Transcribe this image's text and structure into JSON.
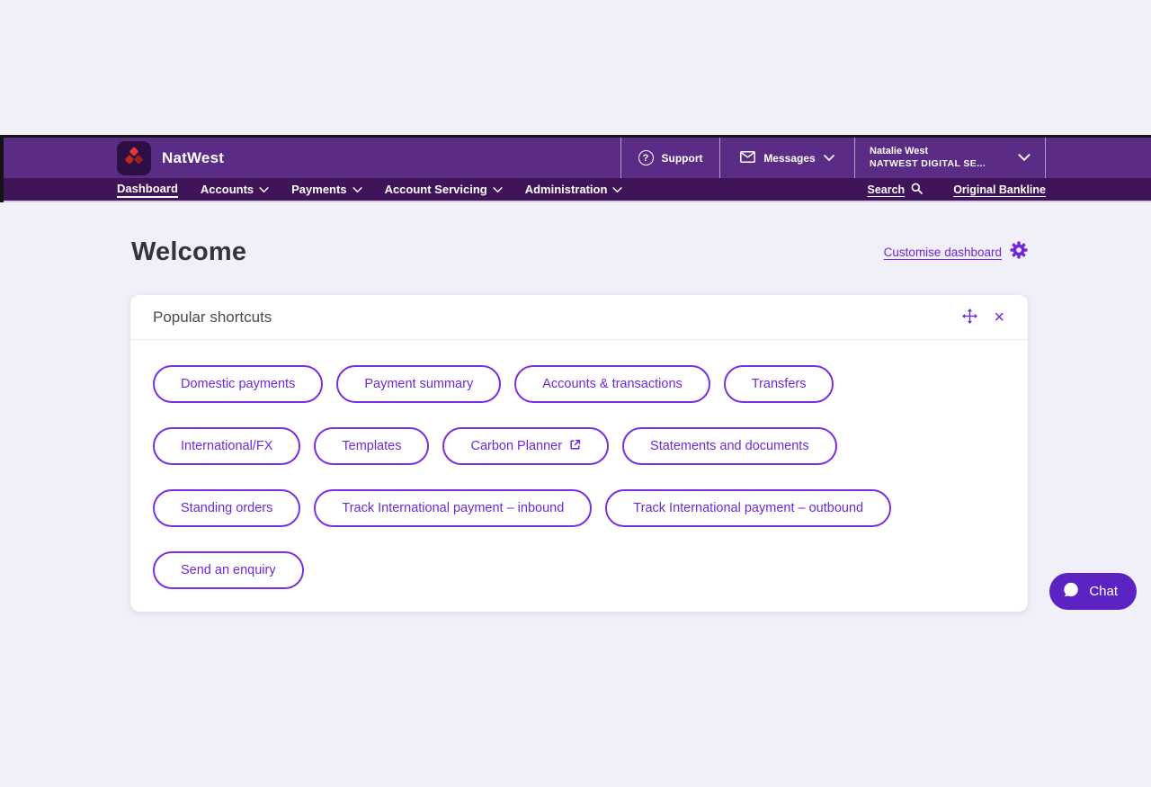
{
  "colors": {
    "header_purple": "#5b2c86",
    "nav_purple": "#401458",
    "accent_purple": "#7127d8",
    "pill_border_purple": "#7b2fe0",
    "chat_purple": "#5c23c3",
    "page_bg": "#f1eff8"
  },
  "header": {
    "brand": "NatWest",
    "support": {
      "label": "Support",
      "icon_glyph": "?"
    },
    "messages": {
      "label": "Messages"
    },
    "user": {
      "name": "Natalie West",
      "org": "NATWEST DIGITAL SE..."
    }
  },
  "nav": {
    "items": [
      {
        "label": "Dashboard",
        "active": true
      },
      {
        "label": "Accounts",
        "active": false
      },
      {
        "label": "Payments",
        "active": false
      },
      {
        "label": "Account Servicing",
        "active": false
      },
      {
        "label": "Administration",
        "active": false
      }
    ],
    "search_label": "Search",
    "original_bankline_label": "Original Bankline"
  },
  "page": {
    "welcome_title": "Welcome",
    "customise_dashboard_label": "Customise dashboard"
  },
  "shortcuts": {
    "title": "Popular shortcuts",
    "close_glyph": "×",
    "rows": [
      {
        "items": [
          {
            "label": "Domestic payments"
          },
          {
            "label": "Payment summary"
          },
          {
            "label": "Accounts & transactions"
          },
          {
            "label": "Transfers"
          }
        ]
      },
      {
        "items": [
          {
            "label": "International/FX"
          },
          {
            "label": "Templates"
          },
          {
            "label": "Carbon Planner",
            "external": true
          },
          {
            "label": "Statements and documents"
          }
        ]
      },
      {
        "items": [
          {
            "label": "Standing orders"
          },
          {
            "label": "Track International payment – inbound"
          },
          {
            "label": "Track International payment – outbound"
          }
        ]
      },
      {
        "items": [
          {
            "label": "Send an enquiry"
          }
        ]
      }
    ]
  },
  "chat": {
    "label": "Chat"
  }
}
